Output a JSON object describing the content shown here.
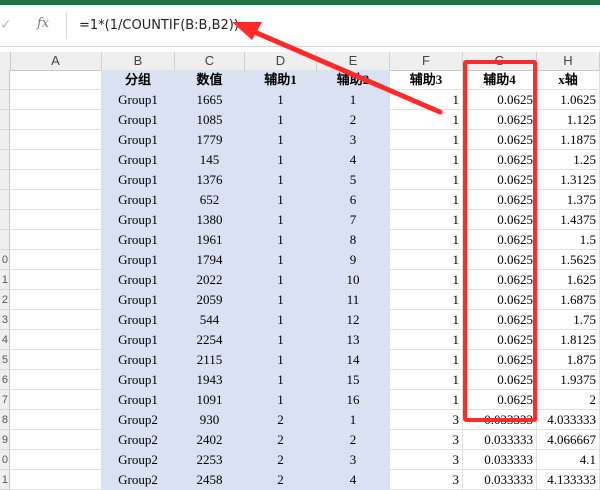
{
  "formula_bar": {
    "confirm_icon": "check-icon",
    "fx_label": "fx",
    "formula": "=1*(1/COUNTIF(B:B,B2))"
  },
  "columns": [
    "A",
    "B",
    "C",
    "D",
    "E",
    "F",
    "G",
    "H"
  ],
  "row_numbers": [
    "",
    "",
    "",
    "",
    "",
    "",
    "",
    "",
    "",
    "0",
    "1",
    "2",
    "3",
    "4",
    "5",
    "6",
    "7",
    "8",
    "9",
    "0",
    "1"
  ],
  "headers": {
    "B": "分组",
    "C": "数值",
    "D": "辅助1",
    "E": "辅助2",
    "F": "辅助3",
    "G": "辅助4",
    "H": "x轴"
  },
  "rows": [
    [
      "Group1",
      "1665",
      "1",
      "1",
      "1",
      "0.0625",
      "1.0625"
    ],
    [
      "Group1",
      "1085",
      "1",
      "2",
      "1",
      "0.0625",
      "1.125"
    ],
    [
      "Group1",
      "1779",
      "1",
      "3",
      "1",
      "0.0625",
      "1.1875"
    ],
    [
      "Group1",
      "145",
      "1",
      "4",
      "1",
      "0.0625",
      "1.25"
    ],
    [
      "Group1",
      "1376",
      "1",
      "5",
      "1",
      "0.0625",
      "1.3125"
    ],
    [
      "Group1",
      "652",
      "1",
      "6",
      "1",
      "0.0625",
      "1.375"
    ],
    [
      "Group1",
      "1380",
      "1",
      "7",
      "1",
      "0.0625",
      "1.4375"
    ],
    [
      "Group1",
      "1961",
      "1",
      "8",
      "1",
      "0.0625",
      "1.5"
    ],
    [
      "Group1",
      "1794",
      "1",
      "9",
      "1",
      "0.0625",
      "1.5625"
    ],
    [
      "Group1",
      "2022",
      "1",
      "10",
      "1",
      "0.0625",
      "1.625"
    ],
    [
      "Group1",
      "2059",
      "1",
      "11",
      "1",
      "0.0625",
      "1.6875"
    ],
    [
      "Group1",
      "544",
      "1",
      "12",
      "1",
      "0.0625",
      "1.75"
    ],
    [
      "Group1",
      "2254",
      "1",
      "13",
      "1",
      "0.0625",
      "1.8125"
    ],
    [
      "Group1",
      "2115",
      "1",
      "14",
      "1",
      "0.0625",
      "1.875"
    ],
    [
      "Group1",
      "1943",
      "1",
      "15",
      "1",
      "0.0625",
      "1.9375"
    ],
    [
      "Group1",
      "1091",
      "1",
      "16",
      "1",
      "0.0625",
      "2"
    ],
    [
      "Group2",
      "930",
      "2",
      "1",
      "3",
      "0.033333",
      "4.033333"
    ],
    [
      "Group2",
      "2402",
      "2",
      "2",
      "3",
      "0.033333",
      "4.066667"
    ],
    [
      "Group2",
      "2253",
      "2",
      "3",
      "3",
      "0.033333",
      "4.1"
    ],
    [
      "Group2",
      "2458",
      "2",
      "4",
      "3",
      "0.033333",
      "4.133333"
    ]
  ],
  "colors": {
    "accent_green": "#217346",
    "highlight_red": "#ff2b2b",
    "band_blue": "#d9e1f2"
  }
}
